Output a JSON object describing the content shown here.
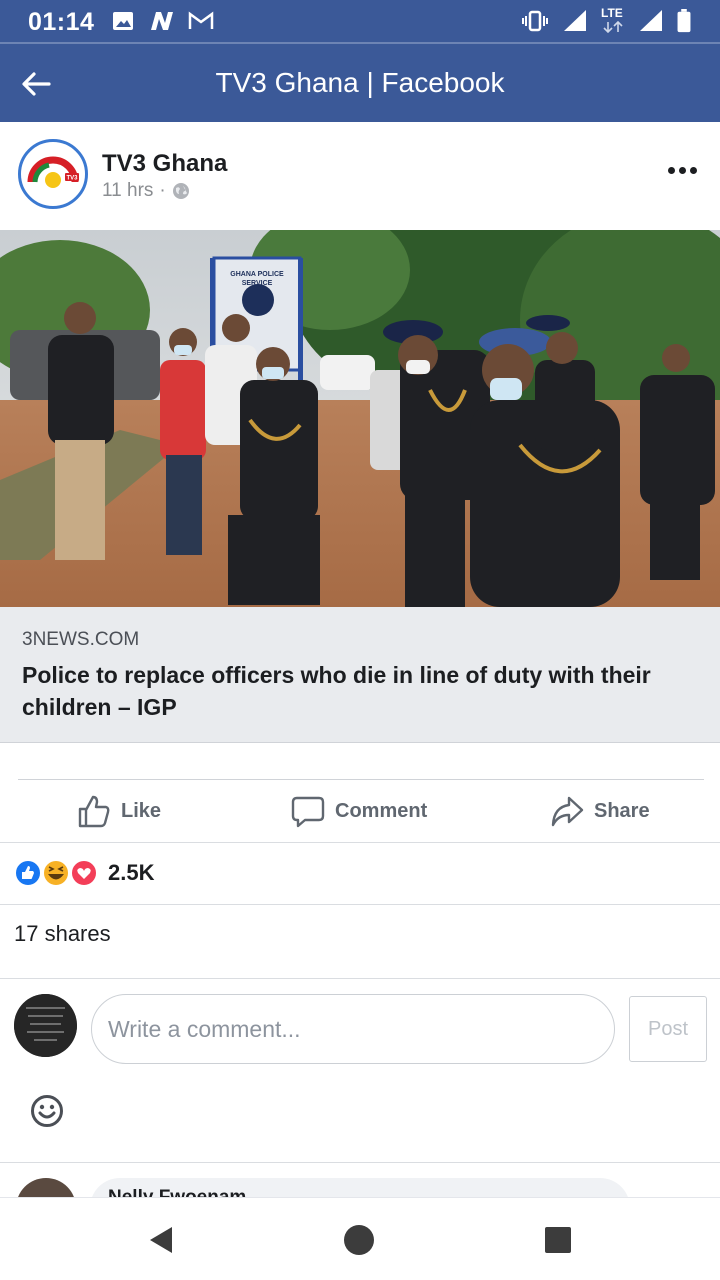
{
  "status_bar": {
    "time": "01:14",
    "network": "LTE",
    "icons": [
      "image-icon",
      "n-app-icon",
      "gmail-icon",
      "vibrate-icon",
      "signal-icon",
      "lte-signal-icon",
      "battery-icon"
    ]
  },
  "header": {
    "title": "TV3 Ghana | Facebook",
    "back_icon": "arrow-left-icon",
    "background": "#3b5998"
  },
  "post": {
    "page_name": "TV3 Ghana",
    "time": "11 hrs",
    "meta_separator": "·",
    "audience_icon": "globe-icon",
    "avatar_logo_text": "TV3",
    "more_icon": "more-dots-icon"
  },
  "link": {
    "domain": "3NEWS.COM",
    "title": "Police to replace officers who die in line of duty with their children – IGP",
    "image_sign_text": "GHANA POLICE SERVICE",
    "image_description_icon": "news-photo"
  },
  "actions": {
    "like": "Like",
    "comment": "Comment",
    "share": "Share"
  },
  "reactions": {
    "count": "2.5K",
    "types": [
      "like-reaction-icon",
      "haha-reaction-icon",
      "love-reaction-icon"
    ]
  },
  "shares": "17 shares",
  "composer": {
    "placeholder": "Write a comment...",
    "post_label": "Post",
    "emoji_icon": "smiley-icon"
  },
  "next_comment": {
    "author": "Nelly Fwoenam"
  },
  "nav": {
    "icons": [
      "back-triangle-icon",
      "home-circle-icon",
      "recents-square-icon"
    ]
  },
  "colors": {
    "brand": "#3b5998",
    "link_preview_bg": "#e9ebee",
    "like_blue": "#1877f2",
    "love_red": "#f33e58",
    "haha_yellow": "#f7b125"
  }
}
